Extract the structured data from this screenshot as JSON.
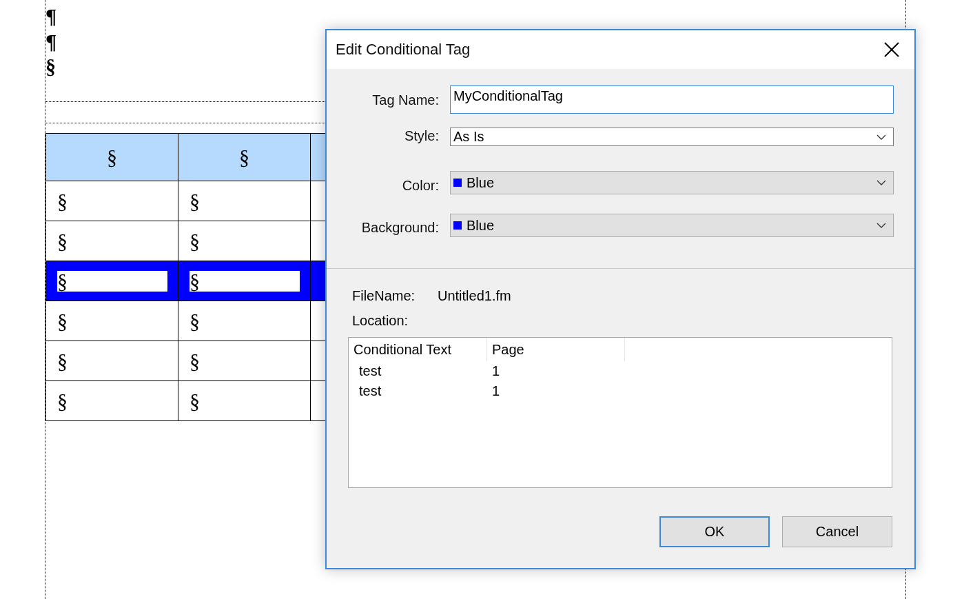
{
  "document": {
    "marks": [
      "¶",
      "¶",
      "§"
    ],
    "table": {
      "header": [
        "§",
        "§"
      ],
      "rows": [
        {
          "cells": [
            "§",
            "§"
          ],
          "selected": false
        },
        {
          "cells": [
            "§",
            "§"
          ],
          "selected": false
        },
        {
          "cells": [
            "§",
            "§"
          ],
          "selected": true
        },
        {
          "cells": [
            "§",
            "§"
          ],
          "selected": false
        },
        {
          "cells": [
            "§",
            "§"
          ],
          "selected": false
        },
        {
          "cells": [
            "§",
            "§"
          ],
          "selected": false
        }
      ]
    }
  },
  "dialog": {
    "title": "Edit Conditional Tag",
    "fields": [
      {
        "label": "Tag Name:",
        "kind": "text",
        "value": "MyConditionalTag"
      },
      {
        "label": "Style:",
        "kind": "select",
        "value": "As Is"
      },
      {
        "label": "Color:",
        "kind": "color-select",
        "value": "Blue",
        "color": "#0000ff"
      },
      {
        "label": "Background:",
        "kind": "color-select",
        "value": "Blue",
        "color": "#0000ff"
      }
    ],
    "file_name": {
      "label": "FileName:",
      "value": "Untitled1.fm"
    },
    "location": {
      "label": "Location:"
    },
    "list": {
      "columns": [
        "Conditional Text",
        "Page"
      ],
      "rows": [
        [
          "test",
          "1"
        ],
        [
          "test",
          "1"
        ]
      ]
    },
    "buttons": [
      {
        "label": "OK",
        "default": true
      },
      {
        "label": "Cancel",
        "default": false
      }
    ]
  }
}
